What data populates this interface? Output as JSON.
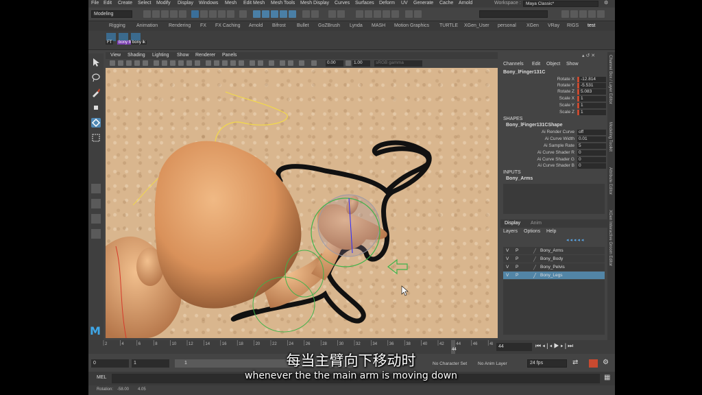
{
  "menu": [
    "File",
    "Edit",
    "Create",
    "Select",
    "Modify",
    "Display",
    "Windows",
    "Mesh",
    "Edit Mesh",
    "Mesh Tools",
    "Mesh Display",
    "Curves",
    "Surfaces",
    "Deform",
    "UV",
    "Generate",
    "Cache",
    "Arnold"
  ],
  "workspace": {
    "label": "Workspace :",
    "value": "Maya Classic*"
  },
  "mode_menu": "Modeling",
  "shelf_tabs": [
    "Rigging",
    "Animation",
    "Rendering",
    "FX",
    "FX Caching",
    "Arnold",
    "Bifrost",
    "Bullet",
    "GoZBrush",
    "Lynda",
    "MASH",
    "Motion Graphics",
    "TURTLE",
    "XGen_User",
    "personal",
    "XGen",
    "VRay",
    "RIGS",
    "test"
  ],
  "shelf_icons": [
    "FT",
    "bony fk",
    "bony ik"
  ],
  "viewport": {
    "menu": [
      "View",
      "Shading",
      "Lighting",
      "Show",
      "Renderer",
      "Panels"
    ],
    "field_a": "0.00",
    "field_b": "1.00",
    "gamma": "sRGB gamma"
  },
  "channel_box": {
    "menu": [
      "Channels",
      "Edit",
      "Object",
      "Show"
    ],
    "node": "Bony_lFinger131C",
    "attributes": [
      {
        "name": "Rotate X",
        "value": "-12.814"
      },
      {
        "name": "Rotate Y",
        "value": "-5.531"
      },
      {
        "name": "Rotate Z",
        "value": "5.083"
      },
      {
        "name": "Scale X",
        "value": "1"
      },
      {
        "name": "Scale Y",
        "value": "1"
      },
      {
        "name": "Scale Z",
        "value": "1"
      }
    ],
    "shapes_title": "SHAPES",
    "shape_node": "Bony_lFinger131CShape",
    "shape_attributes": [
      {
        "name": "Ai Render Curve",
        "value": "off"
      },
      {
        "name": "Ai Curve Width",
        "value": "0.01"
      },
      {
        "name": "Ai Sample Rate",
        "value": "5"
      },
      {
        "name": "Ai Curve Shader R",
        "value": "0"
      },
      {
        "name": "Ai Curve Shader G",
        "value": "0"
      },
      {
        "name": "Ai Curve Shader B",
        "value": "0"
      }
    ],
    "inputs_title": "INPUTS",
    "input_node": "Bony_Arms"
  },
  "layer_editor": {
    "tabs": [
      "Display",
      "Anim"
    ],
    "menu": [
      "Layers",
      "Options",
      "Help"
    ],
    "layers": [
      {
        "v": "V",
        "p": "P",
        "name": "Bony_Arms",
        "selected": false
      },
      {
        "v": "V",
        "p": "P",
        "name": "Bony_Body",
        "selected": false
      },
      {
        "v": "V",
        "p": "P",
        "name": "Bony_Pelvis",
        "selected": false
      },
      {
        "v": "V",
        "p": "P",
        "name": "Bony_Legs",
        "selected": true
      }
    ]
  },
  "side_tabs": [
    "Channel Box / Layer Editor",
    "Modeling Toolkit",
    "Attribute Editor",
    "XGen Interactive Groom Editor"
  ],
  "timeline": {
    "ticks": [
      "2",
      "4",
      "6",
      "8",
      "10",
      "12",
      "14",
      "16",
      "18",
      "20",
      "22",
      "24",
      "26",
      "28",
      "30",
      "32",
      "34",
      "36",
      "38",
      "40",
      "42",
      "44",
      "46",
      "48"
    ],
    "current_frame": "44",
    "frame_field": "44"
  },
  "range": {
    "start": "0",
    "inner_start": "1",
    "inner_end": "1",
    "character_set": "No Character Set",
    "anim_layer": "No Anim Layer",
    "fps": "24 fps"
  },
  "mel_label": "MEL",
  "help_line": {
    "label": "Rotation:",
    "x": "-58.00",
    "y": "4.05"
  },
  "subtitles": {
    "chinese": "每当主臂向下移动时",
    "english": "whenever the the main arm is moving down"
  },
  "colors": {
    "accent": "#5285a6",
    "keyed": "#c84a30",
    "viewport_bg": "#d9b68e"
  }
}
